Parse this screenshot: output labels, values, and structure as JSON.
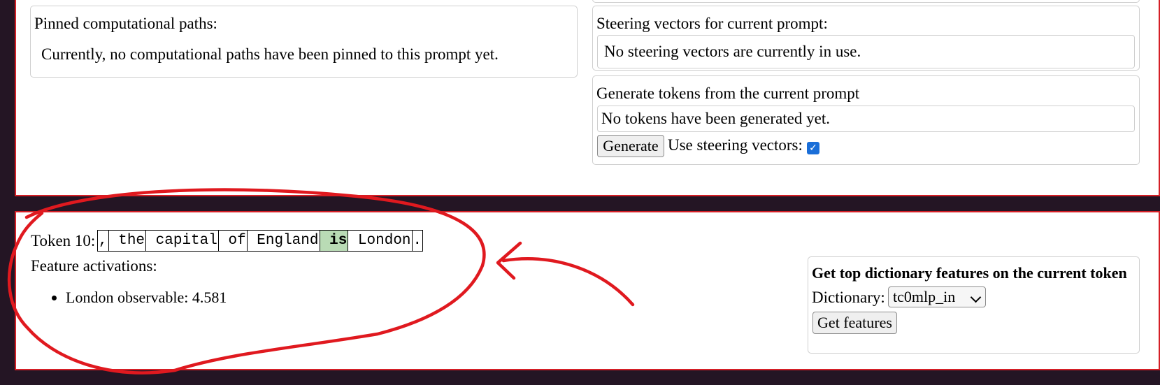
{
  "pinned_paths": {
    "title": "Pinned computational paths:",
    "message": "Currently, no computational paths have been pinned to this prompt yet."
  },
  "steering": {
    "title": "Steering vectors for current prompt:",
    "message": "No steering vectors are currently in use."
  },
  "generate": {
    "title": "Generate tokens from the current prompt",
    "message": "No tokens have been generated yet.",
    "button_label": "Generate",
    "use_steering_label": "Use steering vectors:",
    "use_steering_checked": true
  },
  "token_view": {
    "label": "Token 10:",
    "tokens": [
      ",",
      " the",
      " capital",
      " of",
      " England",
      " is",
      " London",
      "."
    ],
    "active_index": 5,
    "active_color": "#b9dbb5",
    "feature_activations_label": "Feature activations:",
    "features": [
      {
        "text": "London observable: 4.581"
      }
    ]
  },
  "dictionary_panel": {
    "title": "Get top dictionary features on the current token",
    "dictionary_label": "Dictionary:",
    "dictionary_value": "tc0mlp_in",
    "get_features_label": "Get features"
  },
  "colors": {
    "background": "#241524",
    "panel_border": "#d41f26",
    "annotation": "#e0191f",
    "checkbox": "#1a6ed8"
  }
}
